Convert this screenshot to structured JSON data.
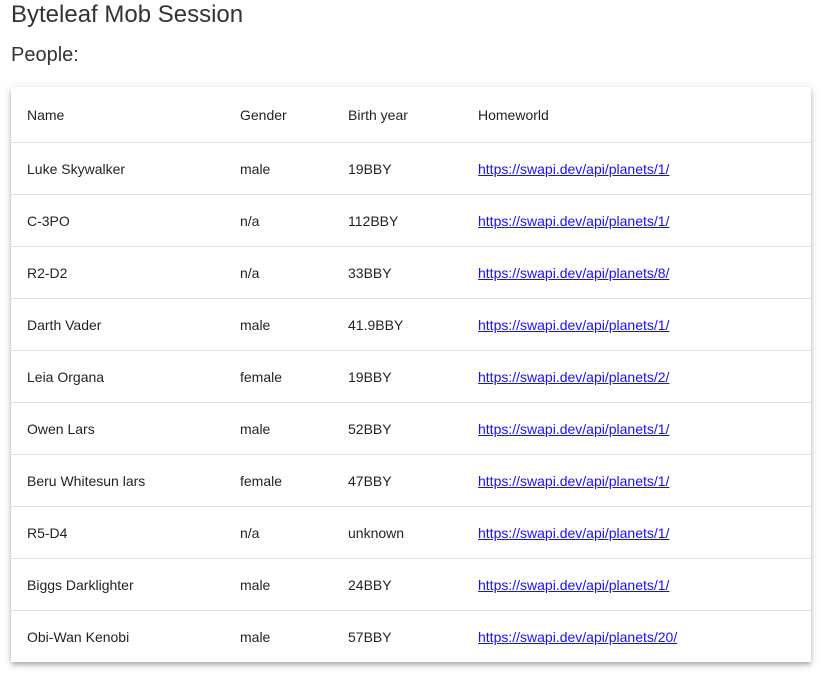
{
  "title": "Byteleaf Mob Session",
  "section_title": "People:",
  "table": {
    "headers": [
      "Name",
      "Gender",
      "Birth year",
      "Homeworld"
    ],
    "rows": [
      [
        "Luke Skywalker",
        "male",
        "19BBY",
        "https://swapi.dev/api/planets/1/"
      ],
      [
        "C-3PO",
        "n/a",
        "112BBY",
        "https://swapi.dev/api/planets/1/"
      ],
      [
        "R2-D2",
        "n/a",
        "33BBY",
        "https://swapi.dev/api/planets/8/"
      ],
      [
        "Darth Vader",
        "male",
        "41.9BBY",
        "https://swapi.dev/api/planets/1/"
      ],
      [
        "Leia Organa",
        "female",
        "19BBY",
        "https://swapi.dev/api/planets/2/"
      ],
      [
        "Owen Lars",
        "male",
        "52BBY",
        "https://swapi.dev/api/planets/1/"
      ],
      [
        "Beru Whitesun lars",
        "female",
        "47BBY",
        "https://swapi.dev/api/planets/1/"
      ],
      [
        "R5-D4",
        "n/a",
        "unknown",
        "https://swapi.dev/api/planets/1/"
      ],
      [
        "Biggs Darklighter",
        "male",
        "24BBY",
        "https://swapi.dev/api/planets/1/"
      ],
      [
        "Obi-Wan Kenobi",
        "male",
        "57BBY",
        "https://swapi.dev/api/planets/20/"
      ]
    ]
  },
  "colors": {
    "link": "#1a0dff"
  }
}
